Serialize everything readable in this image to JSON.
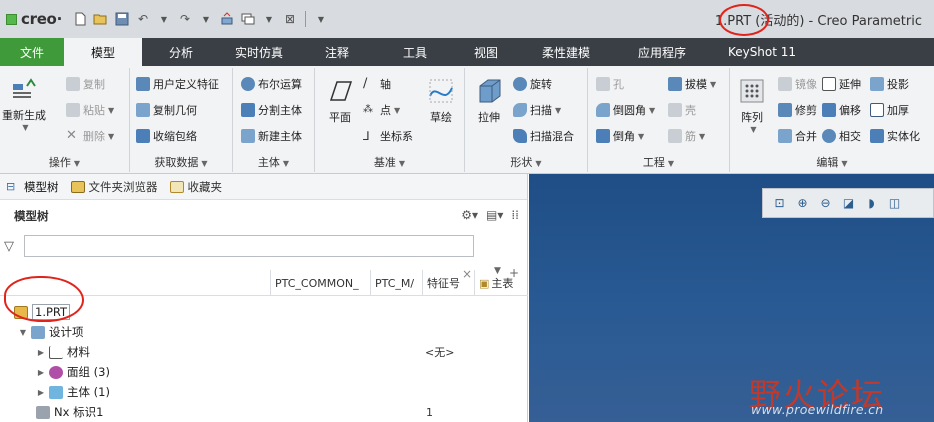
{
  "title_bar": {
    "logo_text": "creo",
    "window_title": "1.PRT (活动的) - Creo Parametric"
  },
  "ribbon": {
    "tabs": [
      {
        "label": "文件"
      },
      {
        "label": "模型"
      },
      {
        "label": "分析"
      },
      {
        "label": "实时仿真"
      },
      {
        "label": "注释"
      },
      {
        "label": "工具"
      },
      {
        "label": "视图"
      },
      {
        "label": "柔性建模"
      },
      {
        "label": "应用程序"
      },
      {
        "label": "KeyShot 11"
      }
    ],
    "groups": {
      "operations": {
        "label": "操作",
        "regen": "重新生成",
        "copy": "复制",
        "paste": "粘贴",
        "delete": "删除"
      },
      "get_data": {
        "label": "获取数据",
        "udf": "用户定义特征",
        "copy_geom": "复制几何",
        "shrinkwrap": "收缩包络"
      },
      "body": {
        "label": "主体",
        "boolean": "布尔运算",
        "split_body": "分割主体",
        "new_body": "新建主体"
      },
      "datum": {
        "label": "基准",
        "plane": "平面",
        "axis": "轴",
        "point": "点",
        "csys": "坐标系",
        "sketch": "草绘"
      },
      "shapes": {
        "label": "形状",
        "extrude": "拉伸",
        "revolve": "旋转",
        "sweep": "扫描",
        "swept_blend": "扫描混合"
      },
      "engineering": {
        "label": "工程",
        "hole": "孔",
        "draft": "拔模",
        "round": "倒圆角",
        "shell": "壳",
        "chamfer": "倒角",
        "rib": "筋"
      },
      "editing": {
        "label": "编辑",
        "pattern": "阵列",
        "mirror": "镜像",
        "extend": "延伸",
        "project": "投影",
        "trim": "修剪",
        "offset": "偏移",
        "thicken": "加厚",
        "merge": "合并",
        "intersect": "相交",
        "solidify": "实体化"
      }
    }
  },
  "panel": {
    "tabs": [
      {
        "label": "模型树"
      },
      {
        "label": "文件夹浏览器"
      },
      {
        "label": "收藏夹"
      }
    ],
    "title": "模型树",
    "search": {
      "value": "",
      "clear": "×"
    },
    "columns": [
      {
        "label": "PTC_COMMON_"
      },
      {
        "label": "PTC_M/"
      },
      {
        "label": "特征号"
      },
      {
        "label": "主表"
      }
    ],
    "tree": {
      "root": "1.PRT",
      "design_items": "设计项",
      "rows": [
        {
          "label": "材料",
          "value": "<无>"
        },
        {
          "label": "面组 (3)",
          "value": ""
        },
        {
          "label": "主体 (1)",
          "value": ""
        },
        {
          "label": "Nx 标识1",
          "value": "1"
        }
      ]
    }
  },
  "watermark": {
    "text": "野火论坛",
    "url": "www.proewildfire.cn"
  },
  "colors": {
    "file_tab": "#3f9b3a",
    "tab_bar": "#3a3f45",
    "graphics_bg": "#1f4e86",
    "annotation": "#e0241b"
  }
}
